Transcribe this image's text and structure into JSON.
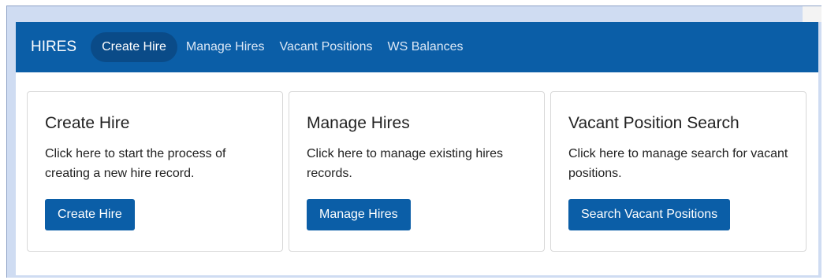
{
  "navbar": {
    "brand": "HIRES",
    "items": [
      {
        "label": "Create Hire",
        "active": true
      },
      {
        "label": "Manage Hires",
        "active": false
      },
      {
        "label": "Vacant Positions",
        "active": false
      },
      {
        "label": "WS Balances",
        "active": false
      }
    ]
  },
  "cards": [
    {
      "title": "Create Hire",
      "text": "Click here to start the process of creating a new hire record.",
      "button": "Create Hire"
    },
    {
      "title": "Manage Hires",
      "text": "Click here to manage existing hires records.",
      "button": "Manage Hires"
    },
    {
      "title": "Vacant Position Search",
      "text": "Click here to manage search for vacant positions.",
      "button": "Search Vacant Positions"
    }
  ],
  "colors": {
    "navbar": "#0b5ea7",
    "active_pill": "#0a4b88",
    "button": "#0b5ea7",
    "frame": "#cfdcf2"
  }
}
